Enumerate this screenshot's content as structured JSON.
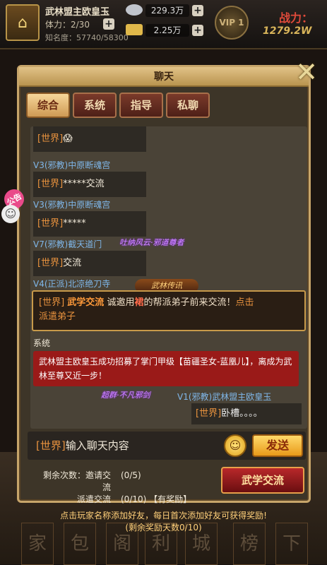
{
  "hud": {
    "name": "武林盟主欧皇玉",
    "stamina": "体力：2/30",
    "fame": "知名度：57740/58300",
    "silver": "229.3万",
    "gold": "2.25万",
    "vip": "VIP 1",
    "power_label": "战力：",
    "power": "1279.2W"
  },
  "side": {
    "notice": "公告",
    "emoji": "☺"
  },
  "panel": {
    "title": "聊天",
    "close": "✕",
    "tabs": [
      "综合",
      "系统",
      "指导",
      "私聊"
    ]
  },
  "chat": {
    "m1_tag": "[世界]",
    "m1_text": "😱",
    "s2": "V3(邪教)中原断魂宫",
    "m2_tag": "[世界]",
    "m2_text": "*****交流",
    "s3": "V3(邪教)中原断魂宫",
    "m3_tag": "[世界]",
    "m3_text": "*****",
    "s4": "V7(邪教)截天道门",
    "s4_title": "吐纳风云·邪道尊者",
    "m4_tag": "[世界]",
    "m4_text": "交流",
    "s5": "V4(正派)北凉绝刀寺",
    "s5_badge": "武林传讯",
    "hl_tag": "[世界]",
    "hl_title": "武学交流",
    "hl_pre": " 诚邀用",
    "hl_red": "裙",
    "hl_post": "的帮派弟子前来交流！",
    "hl_link1": "点击",
    "hl_link2": "派遣弟子",
    "system_label": "系统",
    "system_text": "武林盟主欧皇玉成功招募了掌门甲级【苗疆圣女-蓝凰儿】，离成为武林至尊又近一步！",
    "s6_title": "超群·不凡邪剑",
    "s6": "V1(邪教)武林盟主欧皇玉",
    "m6_tag": "[世界]",
    "m6_text": "卧槽。。。。"
  },
  "input": {
    "tag": "[世界]",
    "placeholder": "输入聊天内容",
    "emoji": "☺",
    "send": "发送"
  },
  "counts": {
    "label_remaining": "剩余次数：",
    "invite_label": "邀请交流",
    "invite_val": "(0/5)",
    "dispatch_label": "派遣交流",
    "dispatch_val": "(0/10)",
    "reward": "【有奖励】",
    "wuxue_button": "武学交流"
  },
  "footer": {
    "line1": "点击玩家名称添加好友，每日首次添加好友可获得奖励!",
    "line2": "(剩余奖励天数0/10)"
  },
  "background_glyphs": [
    "家",
    "包",
    "阁",
    "利",
    "城",
    "榜",
    "下"
  ]
}
